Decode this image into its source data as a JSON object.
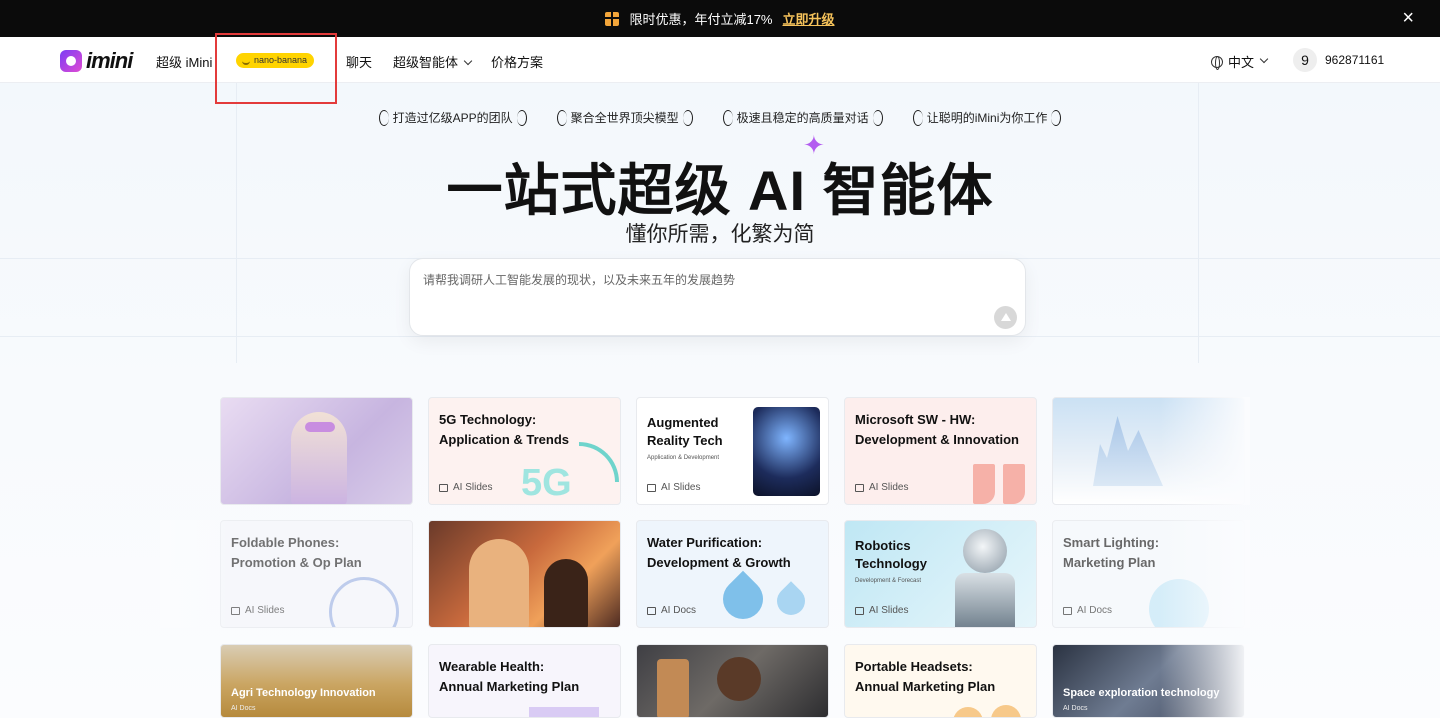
{
  "banner": {
    "promo": "限时优惠，年付立减17%",
    "cta": "立即升级",
    "close": "×"
  },
  "nav": {
    "logo": "imini",
    "items": [
      "超级 iMini",
      "聊天",
      "超级智能体",
      "价格方案"
    ],
    "nano_badge": "nano-banana",
    "language": "中文",
    "avatar_initial": "9",
    "user_id": "962871161"
  },
  "hero": {
    "badges": [
      "打造过亿级APP的团队",
      "聚合全世界顶尖模型",
      "极速且稳定的高质量对话",
      "让聪明的iMini为你工作"
    ],
    "title": "一站式超级 AI 智能体",
    "subtitle": "懂你所需，化繁为简",
    "search_placeholder": "请帮我调研人工智能发展的现状，以及未来五年的发展趋势"
  },
  "cards": [
    {
      "title": "",
      "tag": ""
    },
    {
      "title": "5G Technology:\nApplication & Trends",
      "tag": "AI Slides",
      "art": "5G"
    },
    {
      "title": "Augmented\nReality Tech",
      "sub": "Application & Development",
      "tag": "AI Slides"
    },
    {
      "title": "Microsoft SW - HW:\nDevelopment & Innovation",
      "tag": "AI Slides"
    },
    {
      "title": "",
      "tag": ""
    },
    {
      "title": "Foldable Phones:\nPromotion & Op Plan",
      "tag": "AI Slides"
    },
    {
      "title": "",
      "tag": ""
    },
    {
      "title": "Water Purification:\nDevelopment & Growth",
      "tag": "AI Docs"
    },
    {
      "title": "Robotics\nTechnology",
      "sub": "Development & Forecast",
      "tag": "AI Slides"
    },
    {
      "title": "Smart Lighting:\nMarketing Plan",
      "tag": "AI Docs"
    },
    {
      "title": "Agri Technology Innovation",
      "tag": "AI Docs"
    },
    {
      "title": "Wearable Health:\nAnnual Marketing Plan",
      "tag": ""
    },
    {
      "title": "",
      "tag": ""
    },
    {
      "title": "Portable Headsets:\nAnnual Marketing Plan",
      "tag": ""
    },
    {
      "title": "Space exploration technology",
      "tag": "AI Docs"
    }
  ]
}
